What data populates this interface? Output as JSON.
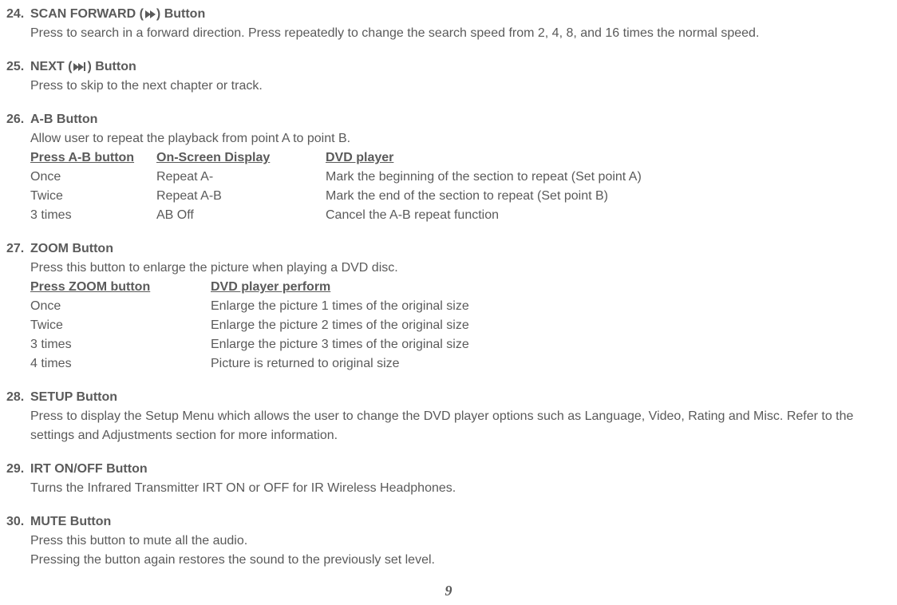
{
  "items": [
    {
      "number": "24.",
      "title_pre": "SCAN FORWARD (",
      "title_post": ") Button",
      "icon": "scan-forward-icon",
      "desc": "Press to search in a forward direction. Press repeatedly to change the search speed from 2, 4, 8, and 16 times the normal speed."
    },
    {
      "number": "25.",
      "title_pre": "NEXT (",
      "title_post": ") Button",
      "icon": "next-icon",
      "desc": "Press to skip to the next chapter or track."
    },
    {
      "number": "26.",
      "title": "A-B Button",
      "desc": "Allow user to repeat the playback from point A to point B.",
      "table": {
        "headers": [
          "Press A-B button",
          "On-Screen Display",
          "DVD player"
        ],
        "rows": [
          [
            "Once",
            "Repeat  A-",
            "Mark the beginning of the section to repeat (Set point A)"
          ],
          [
            "Twice",
            "Repeat  A-B",
            "Mark the end of the section to repeat (Set point B)"
          ],
          [
            "3 times",
            "AB Off",
            "Cancel the A-B repeat function"
          ]
        ]
      }
    },
    {
      "number": "27.",
      "title": "ZOOM  Button",
      "desc": "Press this button to enlarge the picture when playing a DVD disc.",
      "zoom_table": {
        "headers": [
          "Press ZOOM button",
          "DVD player perform"
        ],
        "rows": [
          [
            "Once",
            "Enlarge the picture 1 times of the original size"
          ],
          [
            "Twice",
            "Enlarge the picture 2 times of the original size"
          ],
          [
            "3 times",
            "Enlarge the picture 3 times of the original size"
          ],
          [
            "4 times",
            "Picture is returned to original size"
          ]
        ]
      }
    },
    {
      "number": "28.",
      "title": "SETUP Button",
      "desc": "Press to display the Setup Menu which allows the user to change the DVD player options such as Language, Video, Rating and Misc. Refer to the settings and Adjustments section for more information."
    },
    {
      "number": "29.",
      "title": "IRT ON/OFF Button",
      "desc": "Turns the Infrared Transmitter IRT ON or OFF for IR Wireless Headphones."
    },
    {
      "number": "30.",
      "title": "MUTE Button",
      "desc_lines": [
        "Press this button to mute all the audio.",
        "Pressing the button again restores the sound to the previously set level."
      ]
    }
  ],
  "page_number": "9"
}
